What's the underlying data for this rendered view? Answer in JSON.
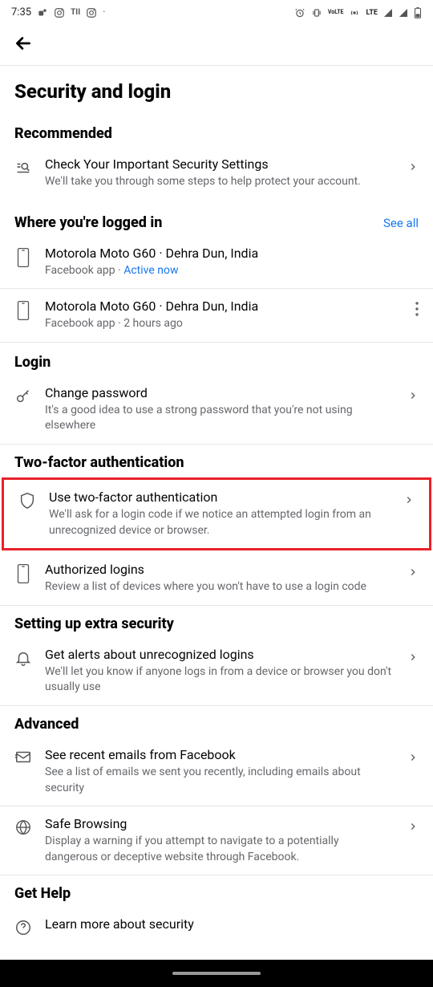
{
  "status": {
    "time": "7:35",
    "lte": "LTE",
    "volte": "VoLTE"
  },
  "header": {
    "back": "←"
  },
  "page_title": "Security and login",
  "sections": {
    "recommended": {
      "title": "Recommended",
      "item": {
        "title": "Check Your Important Security Settings",
        "subtitle": "We'll take you through some steps to help protect your account."
      }
    },
    "logged_in": {
      "title": "Where you're logged in",
      "see_all": "See all",
      "devices": [
        {
          "title": "Motorola Moto G60 · Dehra Dun, India",
          "app": "Facebook app · ",
          "status": "Active now"
        },
        {
          "title": "Motorola Moto G60 · Dehra Dun, India",
          "detail": "Facebook app · 2 hours ago"
        }
      ]
    },
    "login": {
      "title": "Login",
      "item": {
        "title": "Change password",
        "subtitle": "It's a good idea to use a strong password that you're not using elsewhere"
      }
    },
    "twofa": {
      "title": "Two-factor authentication",
      "use": {
        "title": "Use two-factor authentication",
        "subtitle": "We'll ask for a login code if we notice an attempted login from an unrecognized device or browser."
      },
      "authorized": {
        "title": "Authorized logins",
        "subtitle": "Review a list of devices where you won't have to use a login code"
      }
    },
    "extra": {
      "title": "Setting up extra security",
      "alerts": {
        "title": "Get alerts about unrecognized logins",
        "subtitle": "We'll let you know if anyone logs in from a device or browser you don't usually use"
      }
    },
    "advanced": {
      "title": "Advanced",
      "emails": {
        "title_pre": "See recent ",
        "title_em": "emails",
        "title_post": " from Facebook",
        "subtitle": "See a list of emails we sent you recently, including emails about security"
      },
      "safe": {
        "title": "Safe Browsing",
        "subtitle": "Display a warning if you attempt to navigate to a potentially dangerous or deceptive website through Facebook."
      }
    },
    "help": {
      "title": "Get Help",
      "learn": {
        "title": "Learn more about security"
      }
    }
  }
}
